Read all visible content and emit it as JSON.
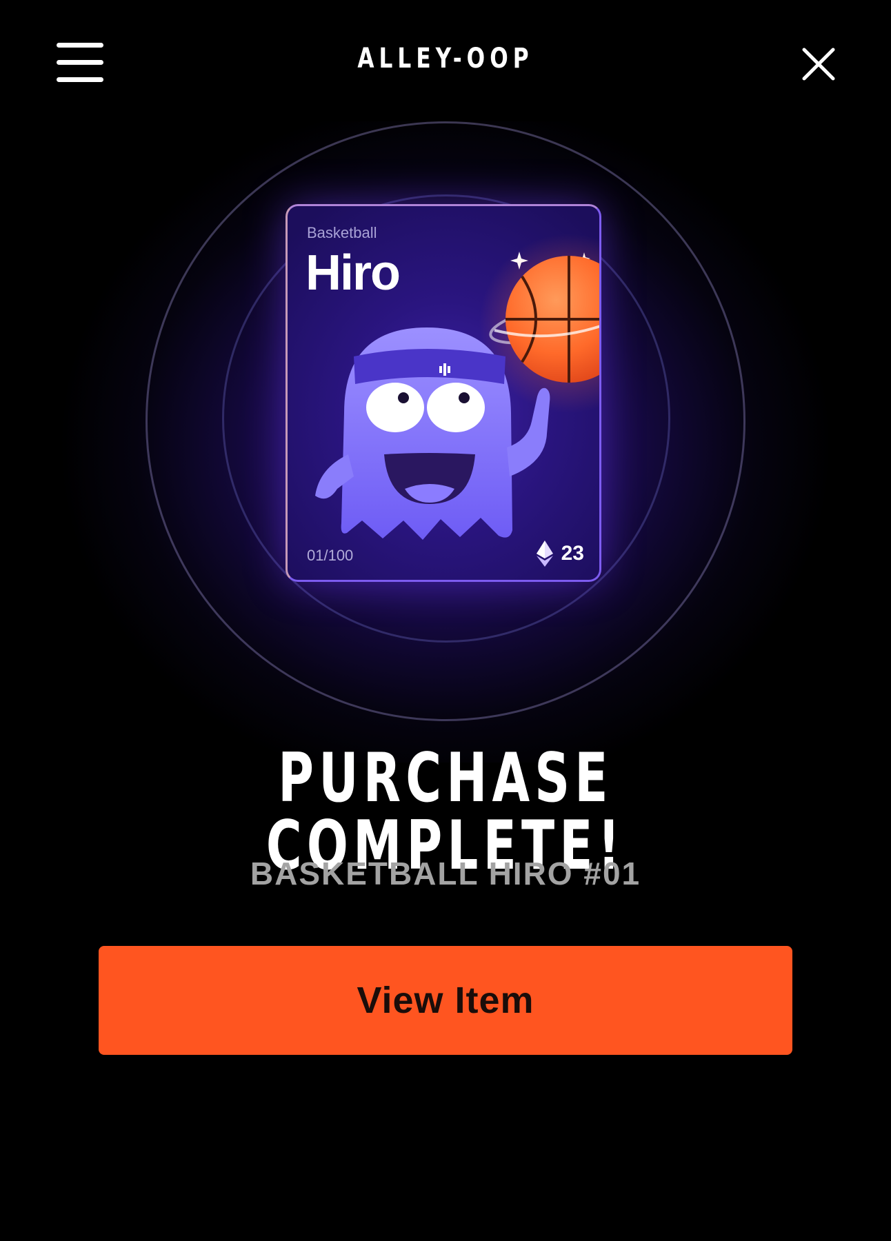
{
  "header": {
    "brand": "ALLEY-OOP",
    "menu_icon": "hamburger-menu-icon",
    "close_icon": "close-icon"
  },
  "card": {
    "sport": "Basketball",
    "name": "Hiro",
    "edition": "01/100",
    "price": "23",
    "price_icon": "ethereum-icon",
    "illustration": "ghost-mascot-spinning-basketball"
  },
  "result": {
    "title": "PURCHASE COMPLETE!",
    "item_name": "BASKETBALL HIRO #01"
  },
  "actions": {
    "view_item_label": "View Item"
  },
  "colors": {
    "background": "#000000",
    "accent": "#ff5520",
    "card_border": "#7d5cf0",
    "glow": "#3d1899",
    "subtitle": "#a3a3a3"
  }
}
